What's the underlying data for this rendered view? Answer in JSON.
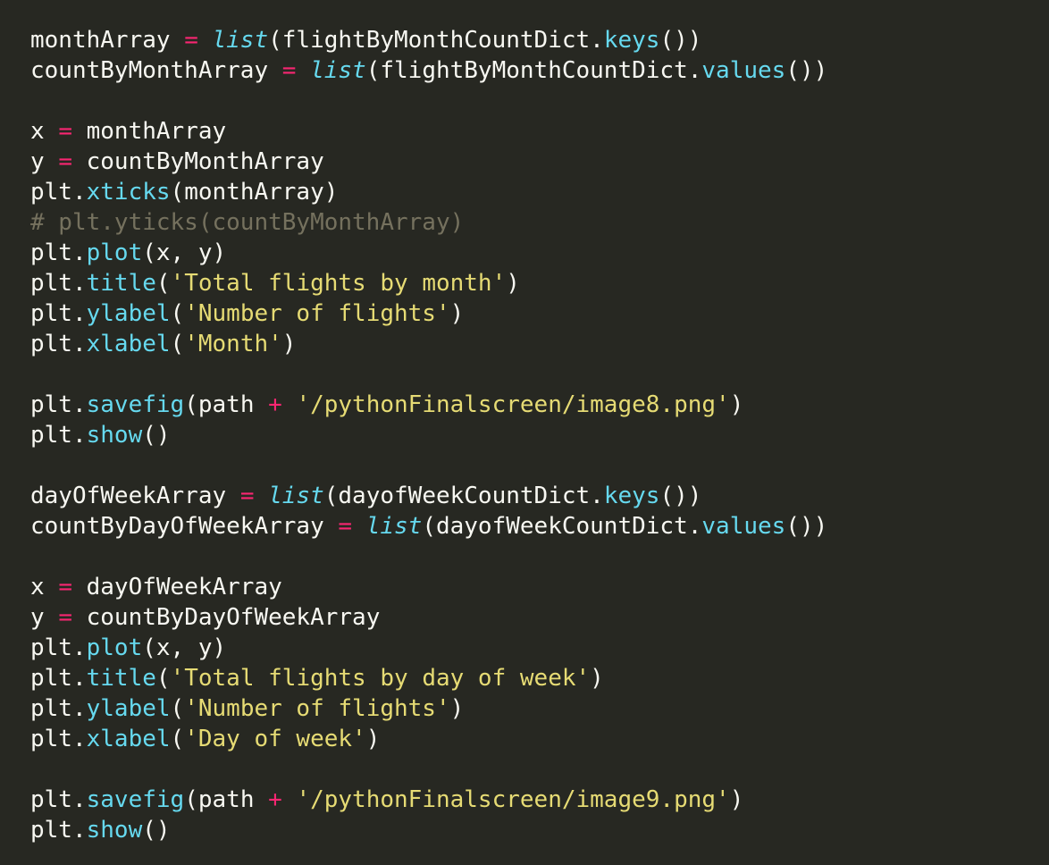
{
  "colors": {
    "background": "#272822",
    "text": "#f8f8f2",
    "operator": "#f92672",
    "function": "#66d9ef",
    "string": "#e6db74",
    "comment": "#75715e"
  },
  "code_lines": [
    [
      [
        "plain",
        "monthArray "
      ],
      [
        "op",
        "="
      ],
      [
        "plain",
        " "
      ],
      [
        "builtin",
        "list"
      ],
      [
        "plain",
        "(flightByMonthCountDict."
      ],
      [
        "fn",
        "keys"
      ],
      [
        "plain",
        "())"
      ]
    ],
    [
      [
        "plain",
        "countByMonthArray "
      ],
      [
        "op",
        "="
      ],
      [
        "plain",
        " "
      ],
      [
        "builtin",
        "list"
      ],
      [
        "plain",
        "(flightByMonthCountDict."
      ],
      [
        "fn",
        "values"
      ],
      [
        "plain",
        "())"
      ]
    ],
    [],
    [
      [
        "plain",
        "x "
      ],
      [
        "op",
        "="
      ],
      [
        "plain",
        " monthArray"
      ]
    ],
    [
      [
        "plain",
        "y "
      ],
      [
        "op",
        "="
      ],
      [
        "plain",
        " countByMonthArray"
      ]
    ],
    [
      [
        "plain",
        "plt."
      ],
      [
        "fn",
        "xticks"
      ],
      [
        "plain",
        "(monthArray)"
      ]
    ],
    [
      [
        "comment",
        "# plt.yticks(countByMonthArray)"
      ]
    ],
    [
      [
        "plain",
        "plt."
      ],
      [
        "fn",
        "plot"
      ],
      [
        "plain",
        "(x, y)"
      ]
    ],
    [
      [
        "plain",
        "plt."
      ],
      [
        "fn",
        "title"
      ],
      [
        "plain",
        "("
      ],
      [
        "str",
        "'Total flights by month'"
      ],
      [
        "plain",
        ")"
      ]
    ],
    [
      [
        "plain",
        "plt."
      ],
      [
        "fn",
        "ylabel"
      ],
      [
        "plain",
        "("
      ],
      [
        "str",
        "'Number of flights'"
      ],
      [
        "plain",
        ")"
      ]
    ],
    [
      [
        "plain",
        "plt."
      ],
      [
        "fn",
        "xlabel"
      ],
      [
        "plain",
        "("
      ],
      [
        "str",
        "'Month'"
      ],
      [
        "plain",
        ")"
      ]
    ],
    [],
    [
      [
        "plain",
        "plt."
      ],
      [
        "fn",
        "savefig"
      ],
      [
        "plain",
        "(path "
      ],
      [
        "op",
        "+"
      ],
      [
        "plain",
        " "
      ],
      [
        "str",
        "'/pythonFinalscreen/image8.png'"
      ],
      [
        "plain",
        ")"
      ]
    ],
    [
      [
        "plain",
        "plt."
      ],
      [
        "fn",
        "show"
      ],
      [
        "plain",
        "()"
      ]
    ],
    [],
    [
      [
        "plain",
        "dayOfWeekArray "
      ],
      [
        "op",
        "="
      ],
      [
        "plain",
        " "
      ],
      [
        "builtin",
        "list"
      ],
      [
        "plain",
        "(dayofWeekCountDict."
      ],
      [
        "fn",
        "keys"
      ],
      [
        "plain",
        "())"
      ]
    ],
    [
      [
        "plain",
        "countByDayOfWeekArray "
      ],
      [
        "op",
        "="
      ],
      [
        "plain",
        " "
      ],
      [
        "builtin",
        "list"
      ],
      [
        "plain",
        "(dayofWeekCountDict."
      ],
      [
        "fn",
        "values"
      ],
      [
        "plain",
        "())"
      ]
    ],
    [],
    [
      [
        "plain",
        "x "
      ],
      [
        "op",
        "="
      ],
      [
        "plain",
        " dayOfWeekArray"
      ]
    ],
    [
      [
        "plain",
        "y "
      ],
      [
        "op",
        "="
      ],
      [
        "plain",
        " countByDayOfWeekArray"
      ]
    ],
    [
      [
        "plain",
        "plt."
      ],
      [
        "fn",
        "plot"
      ],
      [
        "plain",
        "(x, y)"
      ]
    ],
    [
      [
        "plain",
        "plt."
      ],
      [
        "fn",
        "title"
      ],
      [
        "plain",
        "("
      ],
      [
        "str",
        "'Total flights by day of week'"
      ],
      [
        "plain",
        ")"
      ]
    ],
    [
      [
        "plain",
        "plt."
      ],
      [
        "fn",
        "ylabel"
      ],
      [
        "plain",
        "("
      ],
      [
        "str",
        "'Number of flights'"
      ],
      [
        "plain",
        ")"
      ]
    ],
    [
      [
        "plain",
        "plt."
      ],
      [
        "fn",
        "xlabel"
      ],
      [
        "plain",
        "("
      ],
      [
        "str",
        "'Day of week'"
      ],
      [
        "plain",
        ")"
      ]
    ],
    [],
    [
      [
        "plain",
        "plt."
      ],
      [
        "fn",
        "savefig"
      ],
      [
        "plain",
        "(path "
      ],
      [
        "op",
        "+"
      ],
      [
        "plain",
        " "
      ],
      [
        "str",
        "'/pythonFinalscreen/image9.png'"
      ],
      [
        "plain",
        ")"
      ]
    ],
    [
      [
        "plain",
        "plt."
      ],
      [
        "fn",
        "show"
      ],
      [
        "plain",
        "()"
      ]
    ]
  ]
}
